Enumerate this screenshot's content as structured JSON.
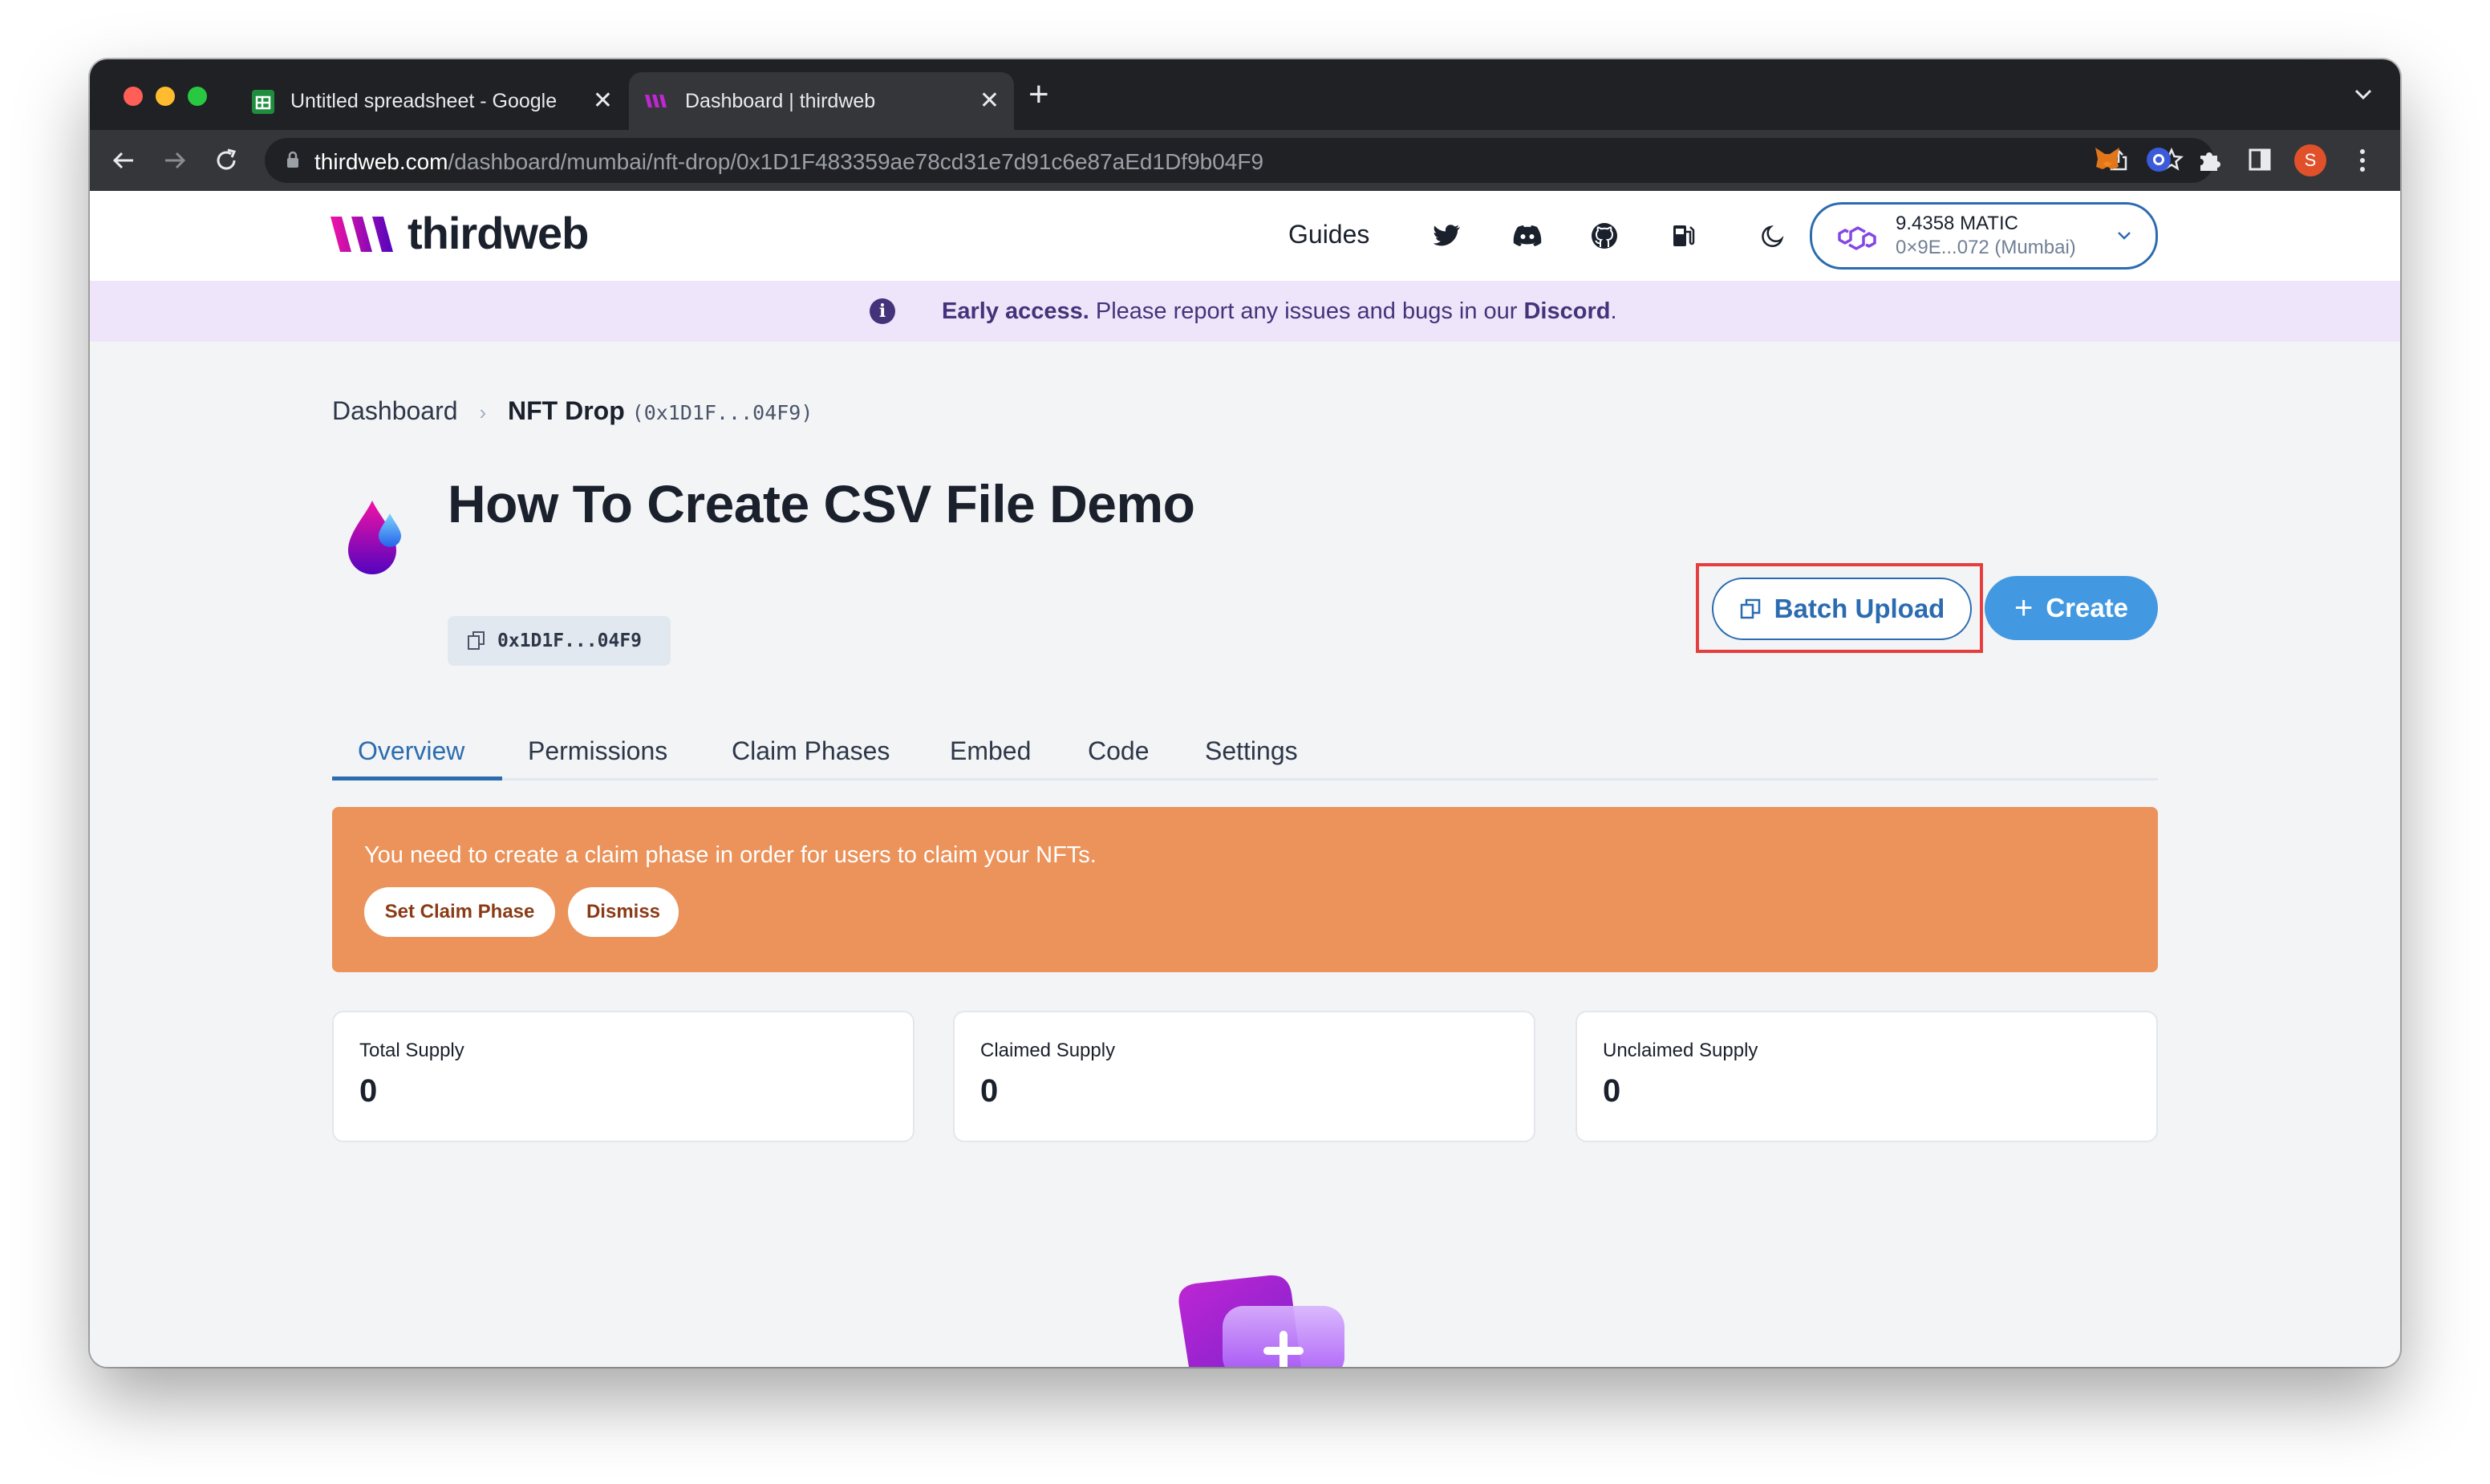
{
  "browser": {
    "tabs": [
      {
        "title": "Untitled spreadsheet - Google",
        "active": false,
        "icon": "google-sheets-icon",
        "icon_color": "#1e8e3e"
      },
      {
        "title": "Dashboard | thirdweb",
        "active": true,
        "icon": "thirdweb-logo-icon",
        "icon_color": "#c026d3"
      }
    ],
    "url_domain": "thirdweb.com",
    "url_path": "/dashboard/mumbai/nft-drop/0x1D1F483359ae78cd31e7d91c6e87aEd1Df9b04F9",
    "profile_initial": "S",
    "profile_color": "#e0512b"
  },
  "header": {
    "brand": "thirdweb",
    "nav_guides": "Guides",
    "nav_icons": [
      "twitter-icon",
      "discord-icon",
      "github-icon",
      "gas-pump-icon",
      "moon-icon"
    ],
    "wallet": {
      "balance": "9.4358 MATIC",
      "address": "0×9E...072 (Mumbai)"
    }
  },
  "banner": {
    "strong": "Early access.",
    "text": " Please report any issues and bugs in our ",
    "link": "Discord",
    "end": "."
  },
  "breadcrumb": {
    "root": "Dashboard",
    "current": "NFT Drop",
    "address": "(0x1D1F...04F9)"
  },
  "contract": {
    "title": "How To Create CSV File Demo",
    "address_chip": "0x1D1F...04F9",
    "batch_upload_label": "Batch Upload",
    "create_label": "Create"
  },
  "tabs": [
    "Overview",
    "Permissions",
    "Claim Phases",
    "Embed",
    "Code",
    "Settings"
  ],
  "active_tab": "Overview",
  "alert": {
    "message": "You need to create a claim phase in order for users to claim your NFTs.",
    "set_claim_phase": "Set Claim Phase",
    "dismiss": "Dismiss"
  },
  "supply_cards": [
    {
      "label": "Total Supply",
      "value": "0"
    },
    {
      "label": "Claimed Supply",
      "value": "0"
    },
    {
      "label": "Unclaimed Supply",
      "value": "0"
    }
  ],
  "colors": {
    "accent_blue": "#2b6cb0",
    "create_button": "#4299e1",
    "alert_orange": "#eb935a",
    "banner_bg": "#efe5fa",
    "highlight_red": "#e53e3e",
    "brand_purple": "#c026d3"
  }
}
